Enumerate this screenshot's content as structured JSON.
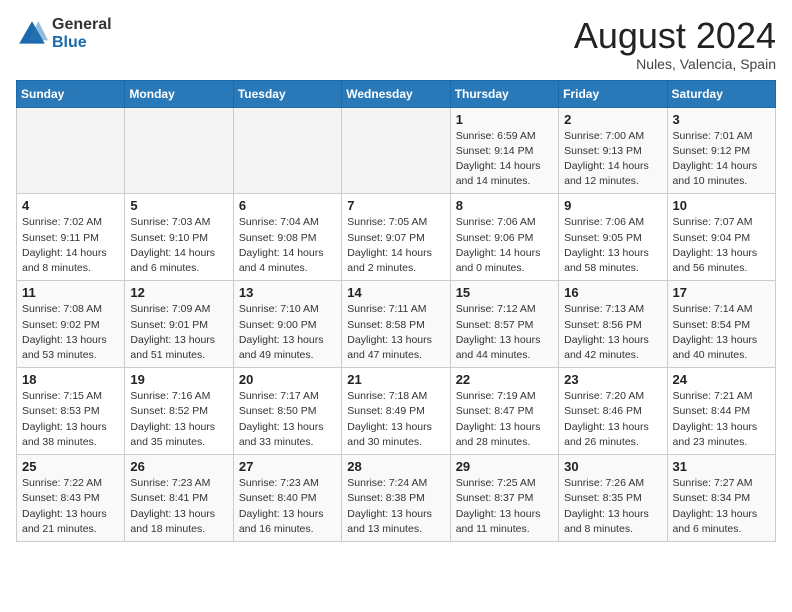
{
  "logo": {
    "general": "General",
    "blue": "Blue"
  },
  "title": {
    "month_year": "August 2024",
    "location": "Nules, Valencia, Spain"
  },
  "weekdays": [
    "Sunday",
    "Monday",
    "Tuesday",
    "Wednesday",
    "Thursday",
    "Friday",
    "Saturday"
  ],
  "weeks": [
    [
      {
        "day": "",
        "info": ""
      },
      {
        "day": "",
        "info": ""
      },
      {
        "day": "",
        "info": ""
      },
      {
        "day": "",
        "info": ""
      },
      {
        "day": "1",
        "info": "Sunrise: 6:59 AM\nSunset: 9:14 PM\nDaylight: 14 hours\nand 14 minutes."
      },
      {
        "day": "2",
        "info": "Sunrise: 7:00 AM\nSunset: 9:13 PM\nDaylight: 14 hours\nand 12 minutes."
      },
      {
        "day": "3",
        "info": "Sunrise: 7:01 AM\nSunset: 9:12 PM\nDaylight: 14 hours\nand 10 minutes."
      }
    ],
    [
      {
        "day": "4",
        "info": "Sunrise: 7:02 AM\nSunset: 9:11 PM\nDaylight: 14 hours\nand 8 minutes."
      },
      {
        "day": "5",
        "info": "Sunrise: 7:03 AM\nSunset: 9:10 PM\nDaylight: 14 hours\nand 6 minutes."
      },
      {
        "day": "6",
        "info": "Sunrise: 7:04 AM\nSunset: 9:08 PM\nDaylight: 14 hours\nand 4 minutes."
      },
      {
        "day": "7",
        "info": "Sunrise: 7:05 AM\nSunset: 9:07 PM\nDaylight: 14 hours\nand 2 minutes."
      },
      {
        "day": "8",
        "info": "Sunrise: 7:06 AM\nSunset: 9:06 PM\nDaylight: 14 hours\nand 0 minutes."
      },
      {
        "day": "9",
        "info": "Sunrise: 7:06 AM\nSunset: 9:05 PM\nDaylight: 13 hours\nand 58 minutes."
      },
      {
        "day": "10",
        "info": "Sunrise: 7:07 AM\nSunset: 9:04 PM\nDaylight: 13 hours\nand 56 minutes."
      }
    ],
    [
      {
        "day": "11",
        "info": "Sunrise: 7:08 AM\nSunset: 9:02 PM\nDaylight: 13 hours\nand 53 minutes."
      },
      {
        "day": "12",
        "info": "Sunrise: 7:09 AM\nSunset: 9:01 PM\nDaylight: 13 hours\nand 51 minutes."
      },
      {
        "day": "13",
        "info": "Sunrise: 7:10 AM\nSunset: 9:00 PM\nDaylight: 13 hours\nand 49 minutes."
      },
      {
        "day": "14",
        "info": "Sunrise: 7:11 AM\nSunset: 8:58 PM\nDaylight: 13 hours\nand 47 minutes."
      },
      {
        "day": "15",
        "info": "Sunrise: 7:12 AM\nSunset: 8:57 PM\nDaylight: 13 hours\nand 44 minutes."
      },
      {
        "day": "16",
        "info": "Sunrise: 7:13 AM\nSunset: 8:56 PM\nDaylight: 13 hours\nand 42 minutes."
      },
      {
        "day": "17",
        "info": "Sunrise: 7:14 AM\nSunset: 8:54 PM\nDaylight: 13 hours\nand 40 minutes."
      }
    ],
    [
      {
        "day": "18",
        "info": "Sunrise: 7:15 AM\nSunset: 8:53 PM\nDaylight: 13 hours\nand 38 minutes."
      },
      {
        "day": "19",
        "info": "Sunrise: 7:16 AM\nSunset: 8:52 PM\nDaylight: 13 hours\nand 35 minutes."
      },
      {
        "day": "20",
        "info": "Sunrise: 7:17 AM\nSunset: 8:50 PM\nDaylight: 13 hours\nand 33 minutes."
      },
      {
        "day": "21",
        "info": "Sunrise: 7:18 AM\nSunset: 8:49 PM\nDaylight: 13 hours\nand 30 minutes."
      },
      {
        "day": "22",
        "info": "Sunrise: 7:19 AM\nSunset: 8:47 PM\nDaylight: 13 hours\nand 28 minutes."
      },
      {
        "day": "23",
        "info": "Sunrise: 7:20 AM\nSunset: 8:46 PM\nDaylight: 13 hours\nand 26 minutes."
      },
      {
        "day": "24",
        "info": "Sunrise: 7:21 AM\nSunset: 8:44 PM\nDaylight: 13 hours\nand 23 minutes."
      }
    ],
    [
      {
        "day": "25",
        "info": "Sunrise: 7:22 AM\nSunset: 8:43 PM\nDaylight: 13 hours\nand 21 minutes."
      },
      {
        "day": "26",
        "info": "Sunrise: 7:23 AM\nSunset: 8:41 PM\nDaylight: 13 hours\nand 18 minutes."
      },
      {
        "day": "27",
        "info": "Sunrise: 7:23 AM\nSunset: 8:40 PM\nDaylight: 13 hours\nand 16 minutes."
      },
      {
        "day": "28",
        "info": "Sunrise: 7:24 AM\nSunset: 8:38 PM\nDaylight: 13 hours\nand 13 minutes."
      },
      {
        "day": "29",
        "info": "Sunrise: 7:25 AM\nSunset: 8:37 PM\nDaylight: 13 hours\nand 11 minutes."
      },
      {
        "day": "30",
        "info": "Sunrise: 7:26 AM\nSunset: 8:35 PM\nDaylight: 13 hours\nand 8 minutes."
      },
      {
        "day": "31",
        "info": "Sunrise: 7:27 AM\nSunset: 8:34 PM\nDaylight: 13 hours\nand 6 minutes."
      }
    ]
  ]
}
